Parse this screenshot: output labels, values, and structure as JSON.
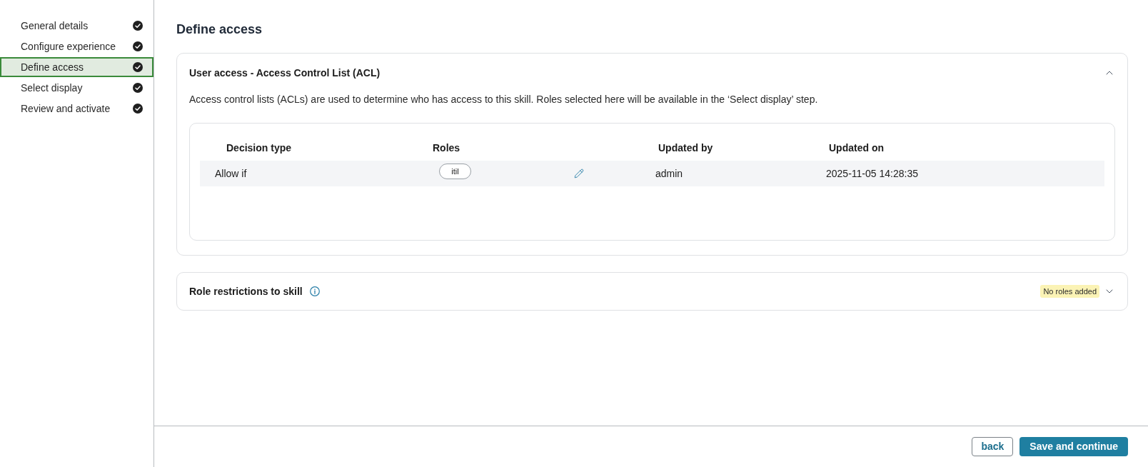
{
  "sidebar": {
    "steps": [
      {
        "label": "General details",
        "selected": false,
        "completed": true
      },
      {
        "label": "Configure experience",
        "selected": false,
        "completed": true
      },
      {
        "label": "Define access",
        "selected": true,
        "completed": true
      },
      {
        "label": "Select display",
        "selected": false,
        "completed": true
      },
      {
        "label": "Review and activate",
        "selected": false,
        "completed": true
      }
    ]
  },
  "page": {
    "title": "Define access"
  },
  "acl_section": {
    "title": "User access - Access Control List (ACL)",
    "expanded": true,
    "description": "Access control lists (ACLs) are used to determine who has access to this skill. Roles selected here will be available in the ‘Select display’ step.",
    "table": {
      "columns": [
        "Decision type",
        "Roles",
        "Updated by",
        "Updated on"
      ],
      "rows": [
        {
          "decision_type": "Allow if",
          "roles": [
            "itil"
          ],
          "updated_by": "admin",
          "updated_on": "2025-11-05 14:28:35"
        }
      ]
    }
  },
  "role_restrictions": {
    "title": "Role restrictions to skill",
    "expanded": false,
    "badge": "No roles added"
  },
  "footer": {
    "buttons": [
      {
        "label": "back",
        "kind": "secondary"
      },
      {
        "label": "Save and continue",
        "kind": "primary"
      }
    ]
  }
}
